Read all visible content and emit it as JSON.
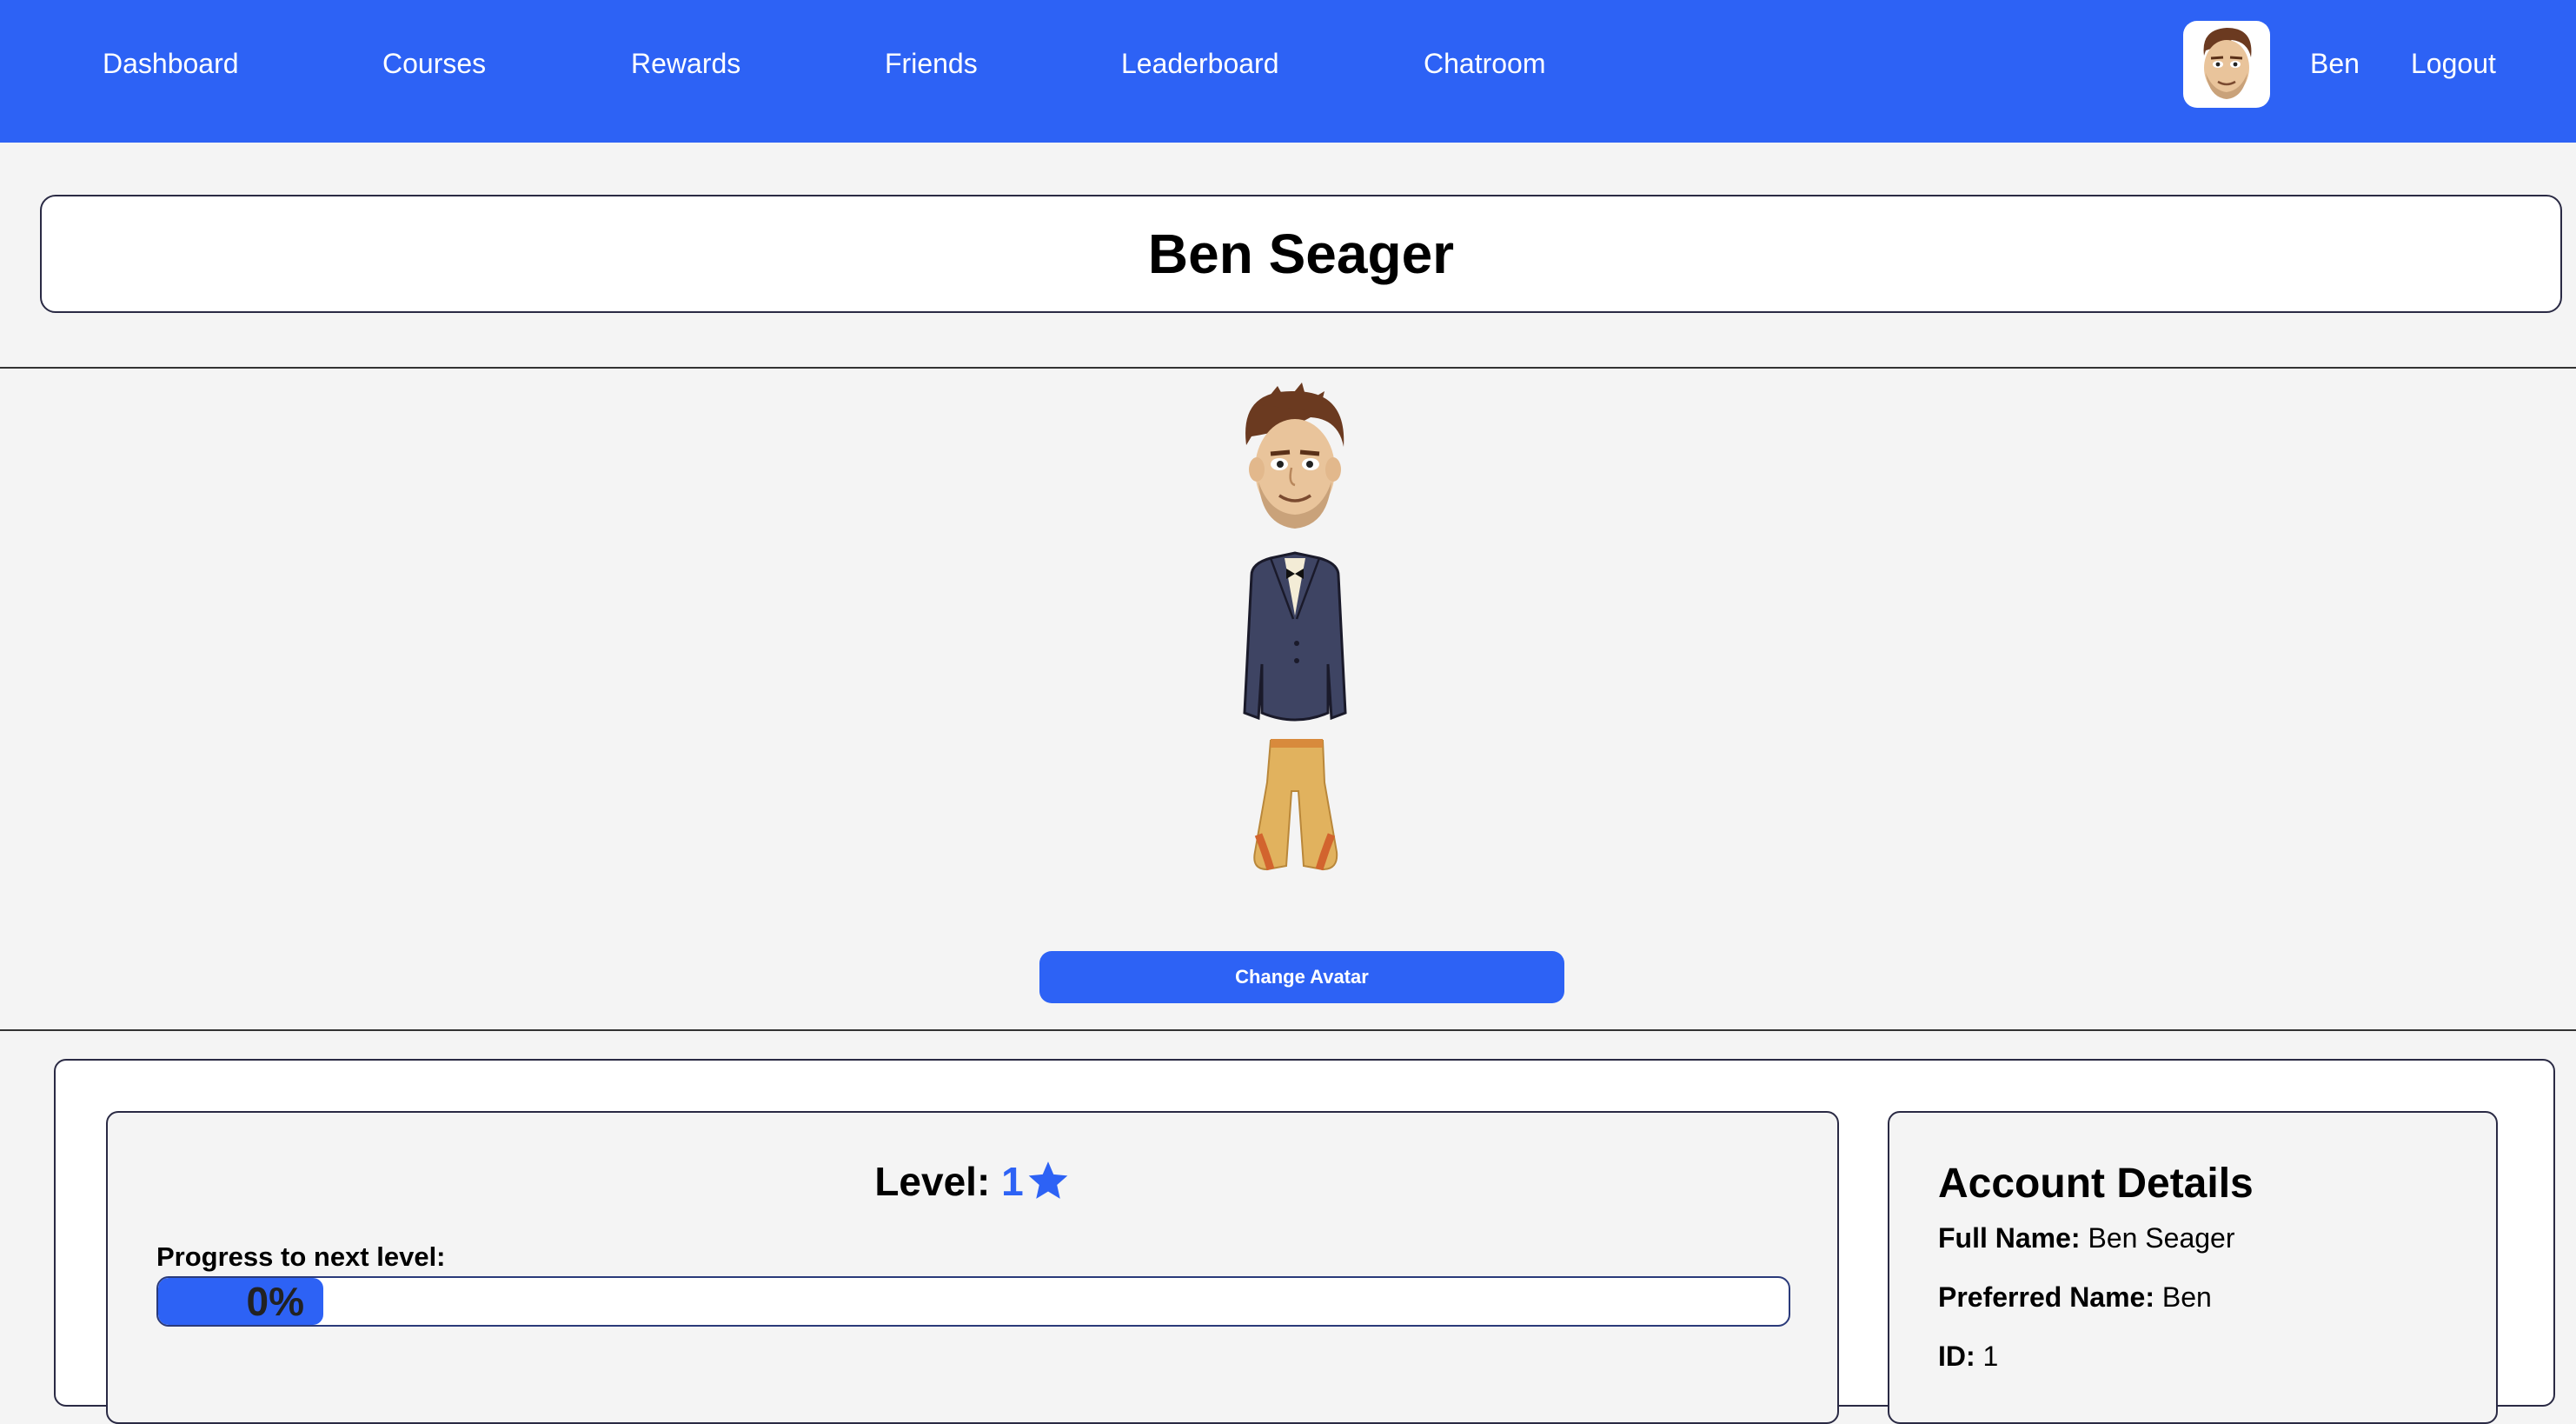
{
  "nav": {
    "links": [
      "Dashboard",
      "Courses",
      "Rewards",
      "Friends",
      "Leaderboard",
      "Chatroom"
    ],
    "user_name": "Ben",
    "logout_label": "Logout"
  },
  "profile": {
    "full_name_heading": "Ben Seager",
    "change_avatar_label": "Change Avatar"
  },
  "level": {
    "label": "Level:",
    "value": "1",
    "progress_label": "Progress to next level:",
    "progress_percent": 0,
    "progress_text": "0%"
  },
  "account": {
    "title": "Account Details",
    "rows": [
      {
        "label": "Full Name:",
        "value": "Ben Seager"
      },
      {
        "label": "Preferred Name:",
        "value": "Ben"
      },
      {
        "label": "ID:",
        "value": "1"
      }
    ]
  },
  "colors": {
    "accent": "#2d62f5",
    "background": "#f4f4f4",
    "border": "#2a2a44"
  },
  "icons": {
    "nav_avatar": "user-avatar-icon",
    "level_star": "star-icon"
  }
}
